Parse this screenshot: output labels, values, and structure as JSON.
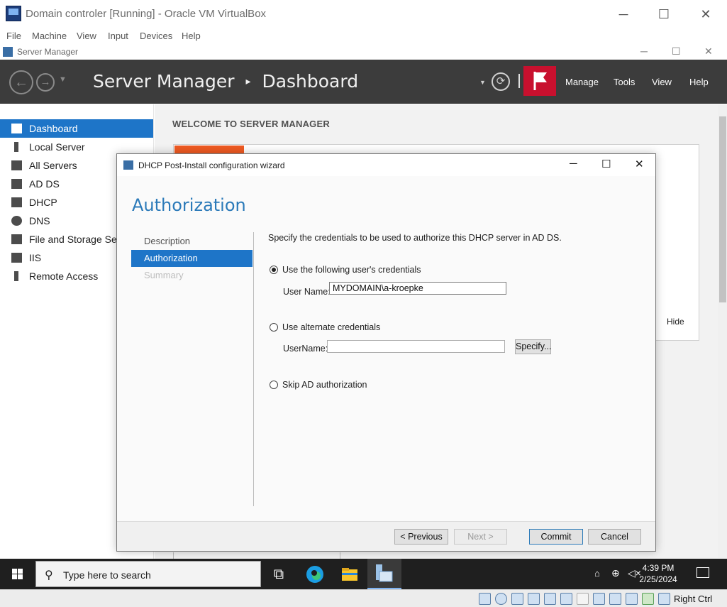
{
  "vbox": {
    "title": "Domain controler [Running] - Oracle VM VirtualBox",
    "menu": [
      "File",
      "Machine",
      "View",
      "Input",
      "Devices",
      "Help"
    ],
    "controls": {
      "minimize": "─",
      "maximize": "☐",
      "close": "✕"
    },
    "status": {
      "host_key": "Right Ctrl"
    }
  },
  "server_manager": {
    "window_title": "Server Manager",
    "header": {
      "app": "Server Manager",
      "separator": "▸",
      "page": "Dashboard",
      "menu": [
        "Manage",
        "Tools",
        "View",
        "Help"
      ]
    },
    "sidebar": {
      "items": [
        {
          "label": "Dashboard",
          "active": true
        },
        {
          "label": "Local Server"
        },
        {
          "label": "All Servers"
        },
        {
          "label": "AD DS"
        },
        {
          "label": "DHCP"
        },
        {
          "label": "DNS"
        },
        {
          "label": "File and Storage Ser"
        },
        {
          "label": "IIS"
        },
        {
          "label": "Remote Access"
        }
      ]
    },
    "main": {
      "welcome_heading": "WELCOME TO SERVER MANAGER",
      "hide_link": "Hide"
    }
  },
  "wizard": {
    "title": "DHCP Post-Install configuration wizard",
    "heading": "Authorization",
    "steps": [
      {
        "label": "Description",
        "state": "normal"
      },
      {
        "label": "Authorization",
        "state": "active"
      },
      {
        "label": "Summary",
        "state": "disabled"
      }
    ],
    "description": "Specify the credentials to be used to authorize this DHCP server in AD DS.",
    "options": {
      "use_current": {
        "label": "Use the following user's credentials",
        "selected": true,
        "field_label": "User Name:",
        "field_value": "MYDOMAIN\\a-kroepke"
      },
      "alternate": {
        "label": "Use alternate credentials",
        "selected": false,
        "field_label": "UserName:",
        "field_value": "",
        "specify_button": "Specify..."
      },
      "skip": {
        "label": "Skip AD authorization",
        "selected": false
      }
    },
    "buttons": {
      "previous": "< Previous",
      "next": "Next >",
      "commit": "Commit",
      "cancel": "Cancel"
    }
  },
  "taskbar": {
    "search_placeholder": "Type here to search",
    "time": "4:39 PM",
    "date": "2/25/2024"
  }
}
